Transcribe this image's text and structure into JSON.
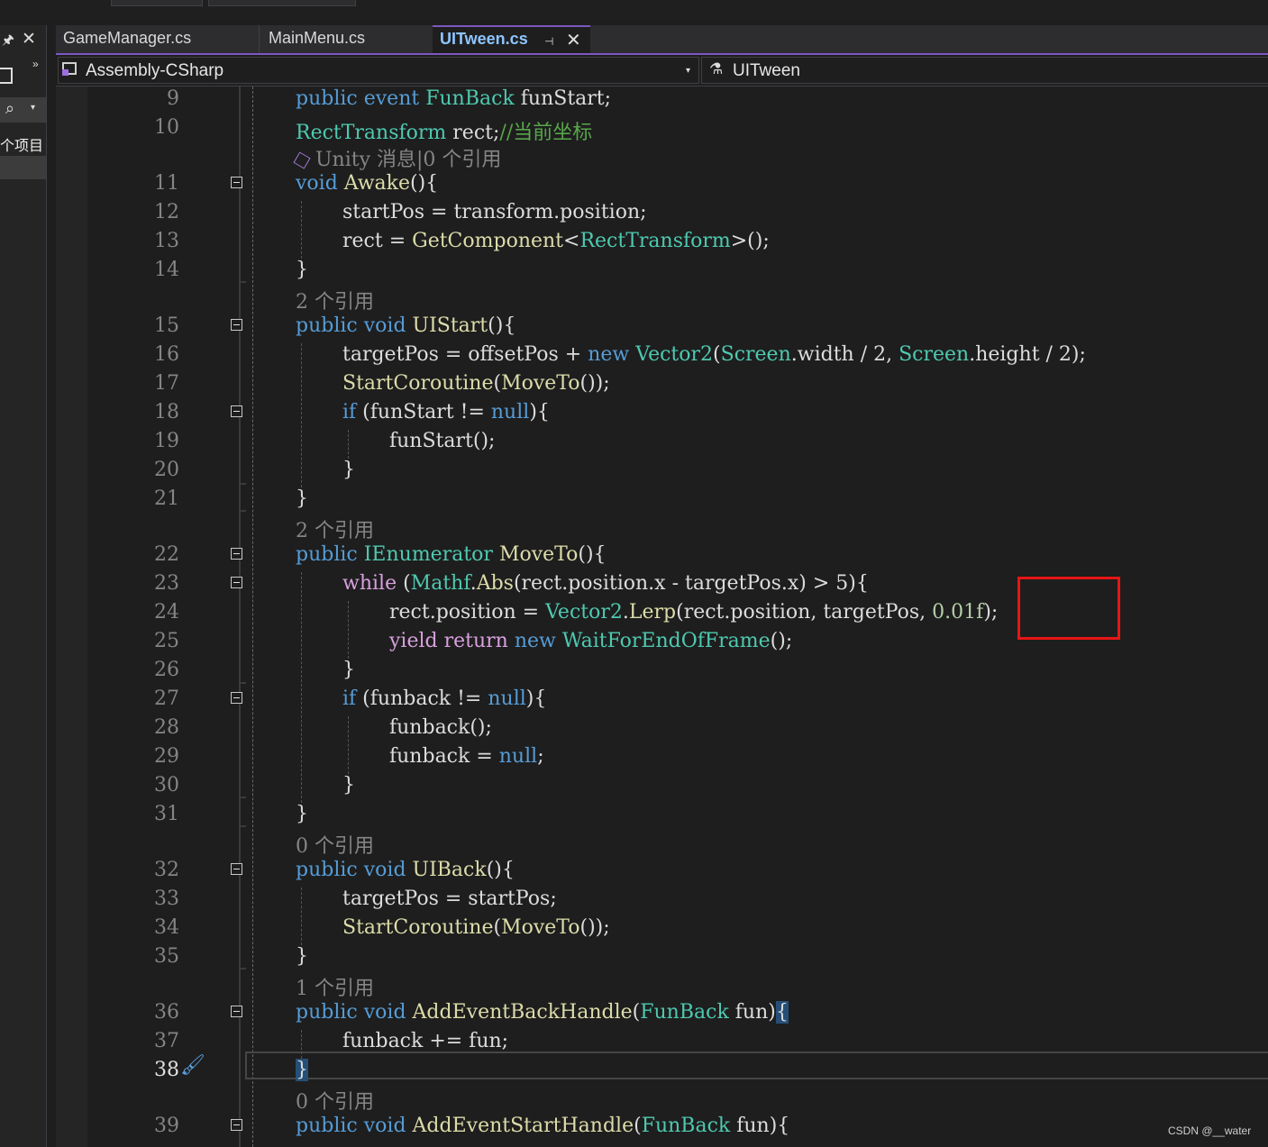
{
  "left_panel": {
    "project_label": "个项目"
  },
  "tabs": [
    {
      "label": "GameManager.cs"
    },
    {
      "label": "MainMenu.cs"
    },
    {
      "label": "UITween.cs"
    }
  ],
  "navbar": {
    "project": "Assembly-CSharp",
    "class": "UITween"
  },
  "lens": {
    "unity": "Unity 消息|0 个引用",
    "refs2": "2 个引用",
    "refs0": "0 个引用",
    "refs1": "1 个引用"
  },
  "line_numbers": [
    "9",
    "10",
    "11",
    "12",
    "13",
    "14",
    "15",
    "16",
    "17",
    "18",
    "19",
    "20",
    "21",
    "22",
    "23",
    "24",
    "25",
    "26",
    "27",
    "28",
    "29",
    "30",
    "31",
    "32",
    "33",
    "34",
    "35",
    "36",
    "37",
    "38",
    "39"
  ],
  "code": {
    "l9": [
      "public",
      "event",
      "FunBack",
      "funStart;"
    ],
    "l10": [
      "RectTransform",
      "rect;",
      "//当前坐标"
    ],
    "l11": [
      "void",
      "Awake",
      "(){"
    ],
    "l12": "startPos = transform.position;",
    "l13": [
      "rect = ",
      "GetComponent",
      "<",
      "RectTransform",
      ">();"
    ],
    "brace_close": "}",
    "l15": [
      "public",
      "void",
      "UIStart",
      "(){"
    ],
    "l16": [
      "targetPos = offsetPos + ",
      "new",
      "Vector2",
      "(",
      "Screen",
      ".width / 2, ",
      "Screen",
      ".height / 2);"
    ],
    "l17": [
      "StartCoroutine",
      "(",
      "MoveTo",
      "());"
    ],
    "l18": [
      "if",
      " (funStart != ",
      "null",
      "){"
    ],
    "l19": [
      "funStart",
      "();"
    ],
    "l22": [
      "public",
      "IEnumerator",
      "MoveTo",
      "(){"
    ],
    "l23": [
      "while",
      " (",
      "Mathf",
      ".",
      "Abs",
      "(rect.position.x - targetPos.x) > 5){"
    ],
    "l24": [
      "rect.position = ",
      "Vector2",
      ".",
      "Lerp",
      "(rect.position, targetPos, ",
      "0.01f",
      ");"
    ],
    "l25": [
      "yield",
      "return",
      "new",
      "WaitForEndOfFrame",
      "();"
    ],
    "l27": [
      "if",
      " (funback != ",
      "null",
      "){"
    ],
    "l28": "funback();",
    "l29": [
      "funback = ",
      "null",
      ";"
    ],
    "l32": [
      "public",
      "void",
      "UIBack",
      "(){"
    ],
    "l33": "targetPos = startPos;",
    "l34": [
      "StartCoroutine",
      "(",
      "MoveTo",
      "());"
    ],
    "l36": [
      "public",
      "void",
      "AddEventBackHandle",
      "(",
      "FunBack",
      " fun)",
      "{"
    ],
    "l37": "funback += fun;",
    "l39": [
      "public",
      "void",
      "AddEventStartHandle",
      "(",
      "FunBack",
      " fun){"
    ]
  },
  "colors": {
    "keyword": "#569cd6",
    "type": "#4ec9b0",
    "method": "#dcdcaa",
    "comment": "#57a64a",
    "highlight_box": "#e81515",
    "accent": "#7e57c2"
  },
  "watermark": "CSDN @__water"
}
